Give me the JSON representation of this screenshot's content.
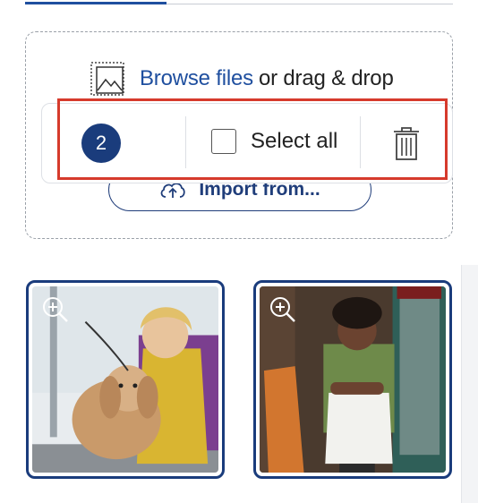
{
  "upload": {
    "browse_link": "Browse files",
    "browse_suffix": "or drag & drop",
    "import_label": "Import from..."
  },
  "selection_toolbar": {
    "count": "2",
    "select_all_label": "Select all"
  },
  "thumbnails": [
    {
      "subject": "Smiling woman with dog at grooming table"
    },
    {
      "subject": "Smiling woman in apron in front of shop"
    }
  ],
  "colors": {
    "accent": "#1f4f9f",
    "badge": "#1a3c7c",
    "highlight": "#d63a2c"
  }
}
